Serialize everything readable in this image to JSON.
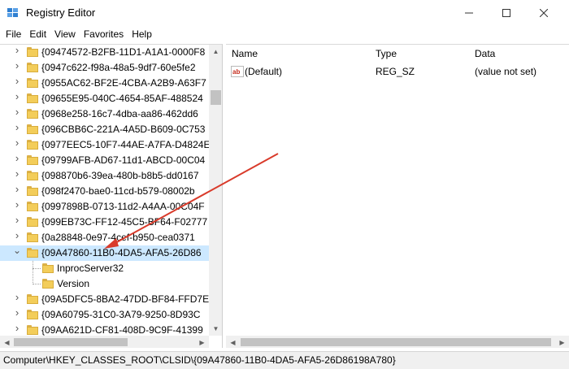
{
  "window": {
    "title": "Registry Editor",
    "app_icon": "registry-editor-icon",
    "controls": {
      "minimize": "minimize-icon",
      "maximize": "maximize-icon",
      "close": "close-icon"
    }
  },
  "menu": [
    "File",
    "Edit",
    "View",
    "Favorites",
    "Help"
  ],
  "tree": {
    "items": [
      {
        "label": "{09474572-B2FB-11D1-A1A1-0000F8",
        "expanded": false,
        "selected": false
      },
      {
        "label": "{0947c622-f98a-48a5-9df7-60e5fe2",
        "expanded": false,
        "selected": false
      },
      {
        "label": "{0955AC62-BF2E-4CBA-A2B9-A63F7",
        "expanded": false,
        "selected": false
      },
      {
        "label": "{09655E95-040C-4654-85AF-488524",
        "expanded": false,
        "selected": false
      },
      {
        "label": "{0968e258-16c7-4dba-aa86-462dd6",
        "expanded": false,
        "selected": false
      },
      {
        "label": "{096CBB6C-221A-4A5D-B609-0C753",
        "expanded": false,
        "selected": false
      },
      {
        "label": "{0977EEC5-10F7-44AE-A7FA-D4824E",
        "expanded": false,
        "selected": false
      },
      {
        "label": "{09799AFB-AD67-11d1-ABCD-00C04",
        "expanded": false,
        "selected": false
      },
      {
        "label": "{098870b6-39ea-480b-b8b5-dd0167",
        "expanded": false,
        "selected": false
      },
      {
        "label": "{098f2470-bae0-11cd-b579-08002b",
        "expanded": false,
        "selected": false
      },
      {
        "label": "{0997898B-0713-11d2-A4AA-00C04F",
        "expanded": false,
        "selected": false
      },
      {
        "label": "{099EB73C-FF12-45C5-BF64-F02777",
        "expanded": false,
        "selected": false
      },
      {
        "label": "{0a28848-0e97-4cef-b950-cea0371",
        "expanded": false,
        "selected": false
      },
      {
        "label": "{09A47860-11B0-4DA5-AFA5-26D86",
        "expanded": true,
        "selected": true
      },
      {
        "label": "InprocServer32",
        "child": true
      },
      {
        "label": "Version",
        "child": true
      },
      {
        "label": "{09A5DFC5-8BA2-47DD-BF84-FFD7E",
        "expanded": false,
        "selected": false
      },
      {
        "label": "{09A60795-31C0-3A79-9250-8D93C",
        "expanded": false,
        "selected": false
      },
      {
        "label": "{09AA621D-CF81-408D-9C9F-41399",
        "expanded": false,
        "selected": false
      }
    ]
  },
  "list": {
    "headers": {
      "name": "Name",
      "type": "Type",
      "data": "Data"
    },
    "rows": [
      {
        "icon": "string-value-icon",
        "name": "(Default)",
        "type": "REG_SZ",
        "data": "(value not set)"
      }
    ]
  },
  "status": {
    "path": "Computer\\HKEY_CLASSES_ROOT\\CLSID\\{09A47860-11B0-4DA5-AFA5-26D86198A780}"
  },
  "annotation": {
    "arrow_color": "#d93b2b"
  }
}
